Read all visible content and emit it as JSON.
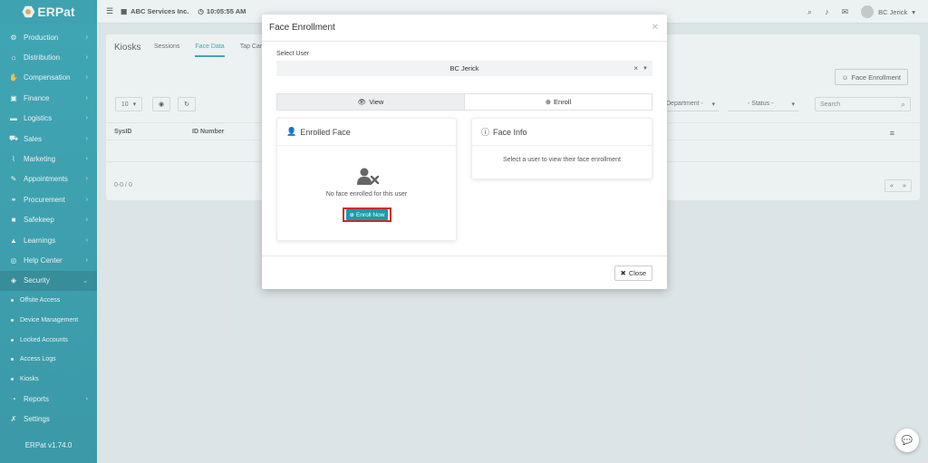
{
  "app": {
    "logo_text": "ERPat",
    "version": "ERPat v1.74.0"
  },
  "topbar": {
    "company": "ABC Services Inc.",
    "time": "10:05:55 AM",
    "user_name": "BC Jerick"
  },
  "sidebar": {
    "items": [
      {
        "label": "Production",
        "icon": "gear-icon"
      },
      {
        "label": "Distribution",
        "icon": "bank-icon"
      },
      {
        "label": "Compensation",
        "icon": "hand-money-icon"
      },
      {
        "label": "Finance",
        "icon": "money-icon"
      },
      {
        "label": "Logistics",
        "icon": "truck-icon"
      },
      {
        "label": "Sales",
        "icon": "cart-icon"
      },
      {
        "label": "Marketing",
        "icon": "chart-line-icon"
      },
      {
        "label": "Appointments",
        "icon": "calendar-edit-icon"
      },
      {
        "label": "Procurement",
        "icon": "handshake-icon"
      },
      {
        "label": "Safekeep",
        "icon": "box-icon"
      },
      {
        "label": "Learnings",
        "icon": "graduation-cap-icon"
      },
      {
        "label": "Help Center",
        "icon": "lifebuoy-icon"
      },
      {
        "label": "Security",
        "icon": "shield-icon"
      }
    ],
    "security_sub": [
      "Offsite Access",
      "Device Management",
      "Locked Accounts",
      "Access Logs",
      "Kiosks"
    ],
    "bottom_items": [
      {
        "label": "Reports",
        "icon": "pie-icon"
      },
      {
        "label": "Settings",
        "icon": "wrench-icon"
      }
    ]
  },
  "page": {
    "title": "Kiosks",
    "tabs": [
      "Sessions",
      "Face Data",
      "Tap Card"
    ],
    "face_enrollment_button": "Face Enrollment",
    "page_size": "10",
    "filters": {
      "department": "Department -",
      "status": "- Status -"
    },
    "search_placeholder": "Search",
    "columns": [
      "SysID",
      "ID Number"
    ],
    "pager_info": "0-0 / 0"
  },
  "modal": {
    "title": "Face Enrollment",
    "select_label": "Select User",
    "selected_user": "BC Jerick",
    "view_tab": "View",
    "enroll_tab": "Enroll",
    "enrolled_face_title": "Enrolled Face",
    "no_face_text": "No face enrolled for this user",
    "enroll_now_button": "Enroll Now",
    "face_info_title": "Face Info",
    "face_info_text": "Select a user to view their face enrollment",
    "close_button": "Close"
  },
  "colors": {
    "accent": "#1a9bab",
    "highlight": "#d9262c"
  }
}
